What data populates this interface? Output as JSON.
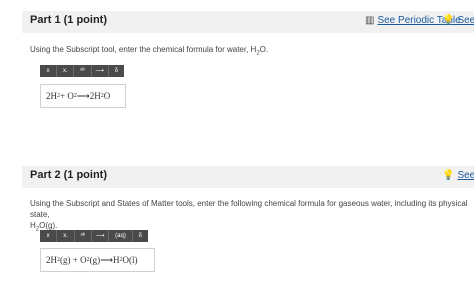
{
  "part1": {
    "title": "Part 1   (1 point)",
    "periodic_table_link": "See Periodic Table",
    "hint_link": "See H",
    "question_prefix": "Using the Subscript tool, enter the chemical formula for water, H",
    "question_sub": "2",
    "question_suffix": "O.",
    "toolbar": [
      "x",
      "x.",
      "ᵃᵇ",
      "⟶",
      "δ"
    ],
    "answer": {
      "a": "2H",
      "a_sub": "2",
      "plus": " + O",
      "plus_sub": "2",
      "arrow": " ⟶ ",
      "b": "2H",
      "b_sub": "2",
      "b_end": "O"
    }
  },
  "part2": {
    "title": "Part 2   (1 point)",
    "hint_link": "See H",
    "question_line1": "Using the Subscript and States of Matter tools, enter the following chemical formula for gaseous water, including its physical state,",
    "question_line2_a": "H",
    "question_line2_sub": "2",
    "question_line2_b": "O(g).",
    "toolbar": [
      "x",
      "x.",
      "ᵃᵇ",
      "⟶",
      "(aq)",
      "δ"
    ],
    "answer": {
      "a": "2H",
      "a_sub": "2",
      "a_state": "(g) + O",
      "b_sub": "2",
      "b_state": "(g)",
      "arrow": " ⟶ ",
      "c": "H",
      "c_sub": "2",
      "c_end": "O(l)"
    }
  }
}
